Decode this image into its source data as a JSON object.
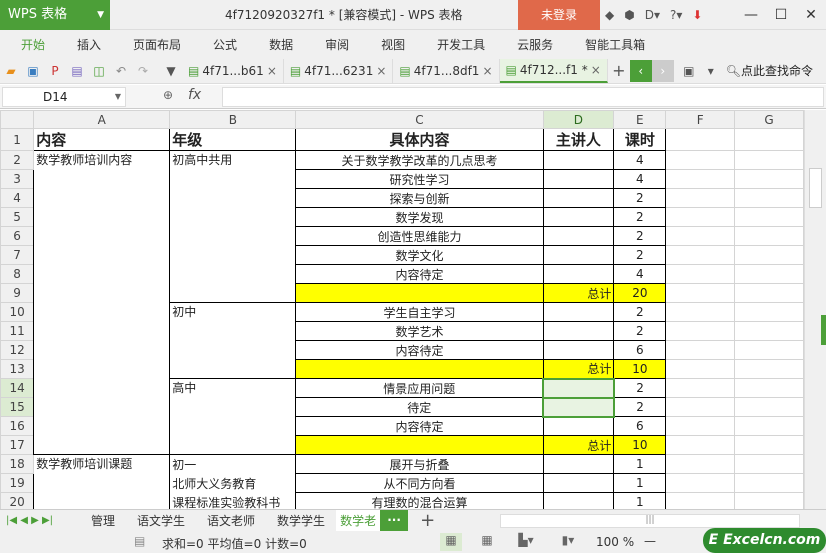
{
  "app": {
    "logo": "WPS 表格",
    "title": "4f7120920327f1 * [兼容模式] - WPS 表格",
    "login": "未登录"
  },
  "menu": [
    "开始",
    "插入",
    "页面布局",
    "公式",
    "数据",
    "审阅",
    "视图",
    "开发工具",
    "云服务",
    "智能工具箱"
  ],
  "doc_tabs": [
    {
      "label": "4f71...b61"
    },
    {
      "label": "4f71...6231"
    },
    {
      "label": "4f71...8df1"
    },
    {
      "label": "4f712...f1 *",
      "active": true
    }
  ],
  "search_command": "点此查找命令",
  "formula": {
    "cell_ref": "D14",
    "fx": "fx",
    "value": ""
  },
  "columns": [
    "A",
    "B",
    "C",
    "D",
    "E",
    "F",
    "G"
  ],
  "header_row": {
    "A": "内容",
    "B": "年级",
    "C": "具体内容",
    "D": "主讲人",
    "E": "课时"
  },
  "groups": {
    "A2": "数学教师培训内容",
    "B2": "初高中共用",
    "B10": "初中",
    "B14": "高中",
    "A18": "数学教师培训课题"
  },
  "rows": [
    {
      "n": "2",
      "C": "关于数学教学改革的几点思考",
      "E": "4"
    },
    {
      "n": "3",
      "C": "研究性学习",
      "E": "4"
    },
    {
      "n": "4",
      "C": "探索与创新",
      "E": "2"
    },
    {
      "n": "5",
      "C": "数学发现",
      "E": "2"
    },
    {
      "n": "6",
      "C": "创造性思维能力",
      "E": "2"
    },
    {
      "n": "7",
      "C": "数学文化",
      "E": "2"
    },
    {
      "n": "8",
      "C": "内容待定",
      "E": "4"
    },
    {
      "n": "9",
      "D": "总计",
      "E": "20",
      "total": true
    },
    {
      "n": "10",
      "C": "学生自主学习",
      "E": "2"
    },
    {
      "n": "11",
      "C": "数学艺术",
      "E": "2"
    },
    {
      "n": "12",
      "C": "内容待定",
      "E": "6"
    },
    {
      "n": "13",
      "D": "总计",
      "E": "10",
      "total": true
    },
    {
      "n": "14",
      "C": "情景应用问题",
      "E": "2"
    },
    {
      "n": "15",
      "C": "待定",
      "E": "2"
    },
    {
      "n": "16",
      "C": "内容待定",
      "E": "6"
    },
    {
      "n": "17",
      "D": "总计",
      "E": "10",
      "total": true
    },
    {
      "n": "18",
      "B": "初一",
      "C": "展开与折叠",
      "E": "1"
    },
    {
      "n": "19",
      "B": "北师大义务教育",
      "C": "从不同方向看",
      "E": "1"
    },
    {
      "n": "20",
      "B": "课程标准实验教科书",
      "C": "有理数的混合运算",
      "E": "1"
    }
  ],
  "sheets": [
    "管理",
    "语文学生",
    "语文老师",
    "数学学生",
    "数学老"
  ],
  "status": {
    "sum": "求和=0",
    "avg": "平均值=0",
    "count": "计数=0",
    "zoom": "100 %"
  },
  "watermark": "Excelcn.com",
  "colors": {
    "accent": "#4c9f38",
    "total_fill": "#ffff00",
    "login": "#e0694a"
  }
}
